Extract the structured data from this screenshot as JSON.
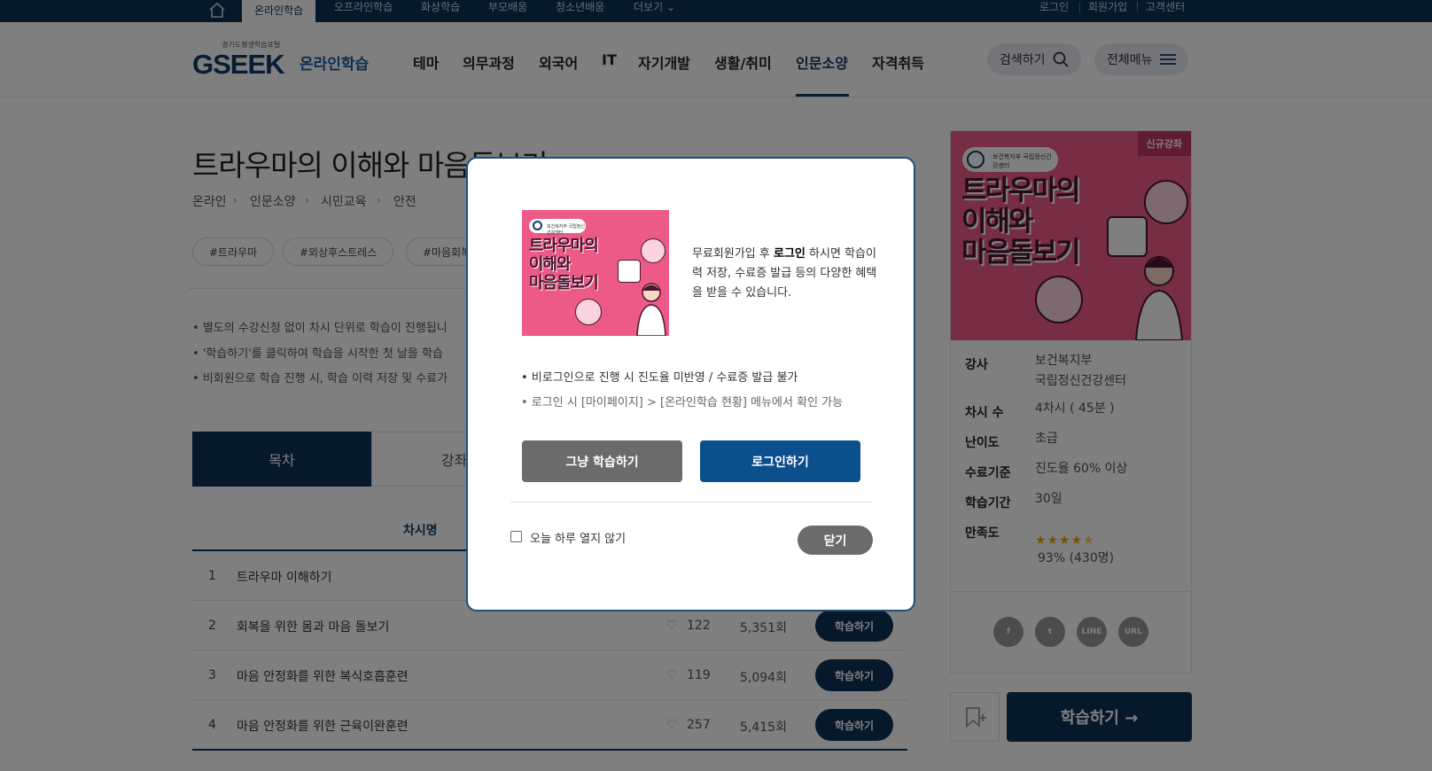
{
  "topbar": {
    "tabs": [
      "온라인학습",
      "오프라인학습",
      "화상학습",
      "부모배움",
      "청소년배움",
      "더보기"
    ],
    "util": [
      "로그인",
      "회원가입",
      "고객센터"
    ]
  },
  "header": {
    "logo_sub": "경기도평생학습포털",
    "logo": "GSEEK",
    "logo_text": "온라인학습",
    "gnb": [
      "테마",
      "의무과정",
      "외국어",
      "IT",
      "자기개발",
      "생활/취미",
      "인문소양",
      "자격취득"
    ],
    "search_label": "검색하기",
    "menu_label": "전체메뉴"
  },
  "course": {
    "title": "트라우마의 이해와 마음돌보기",
    "breadcrumb": [
      "온라인",
      "인문소양",
      "시민교육",
      "안전"
    ],
    "tags": [
      "#트라우마",
      "#외상후스트레스",
      "#마음회복"
    ],
    "notes": [
      "• 별도의 수강신청 없이 차시 단위로 학습이 진행됩니",
      "• '학습하기'를 클릭하여 학습을 시작한 첫 날을 학습",
      "• 비회원으로 학습 진행 시, 학습 이력 저장 및 수료가"
    ],
    "tab_on": "목차",
    "tab_off": "강좌정"
  },
  "table": {
    "header": "차시명",
    "rows": [
      {
        "no": "1",
        "name": "트라우마 이해하기",
        "likes": "",
        "views": "",
        "btn": ""
      },
      {
        "no": "2",
        "name": "회복을 위한 몸과 마음 돌보기",
        "likes": "122",
        "views": "5,351회",
        "btn": "학습하기"
      },
      {
        "no": "3",
        "name": "마음 안정화를 위한 복식호흡훈련",
        "likes": "119",
        "views": "5,094회",
        "btn": "학습하기"
      },
      {
        "no": "4",
        "name": "마음 안정화를 위한 근육이완훈련",
        "likes": "257",
        "views": "5,415회",
        "btn": "학습하기"
      }
    ]
  },
  "card": {
    "badge": "신규강좌",
    "ministry": "보건복지부 국립정신건강센터",
    "poster_title": [
      "트라우마의",
      "이해와",
      "마음돌보기"
    ],
    "info": [
      {
        "k": "강사",
        "v": [
          "보건복지부",
          "국립정신건강센터"
        ]
      },
      {
        "k": "차시 수",
        "v": [
          "4차시 ( 45분 )"
        ]
      },
      {
        "k": "난이도",
        "v": [
          "초급"
        ]
      },
      {
        "k": "수료기준",
        "v": [
          "진도율 60% 이상"
        ]
      },
      {
        "k": "학습기간",
        "v": [
          "30일"
        ]
      },
      {
        "k": "만족도",
        "v": [
          "93% (430명)"
        ]
      }
    ],
    "rating": 4.5,
    "sns": [
      "f",
      "t",
      "LINE",
      "URL"
    ],
    "start_label": "학습하기 →"
  },
  "modal": {
    "intro_pre": "무료회원가입 후 ",
    "intro_bold": "로그인",
    "intro_post": " 하시면 학습이력 저장, 수료증 발급 등의 다양한 혜택을 받을 수 있습니다.",
    "bullet1": "• 비로그인으로 진행 시 진도율 미반영 / 수료증 발급 불가",
    "bullet2": "• 로그인 시 [마이페이지] > [온라인학습 현황] 메뉴에서 확인 가능",
    "btn_guest": "그냥 학습하기",
    "btn_login": "로그인하기",
    "dont_show": "오늘 하루 열지 않기",
    "close": "닫기"
  }
}
